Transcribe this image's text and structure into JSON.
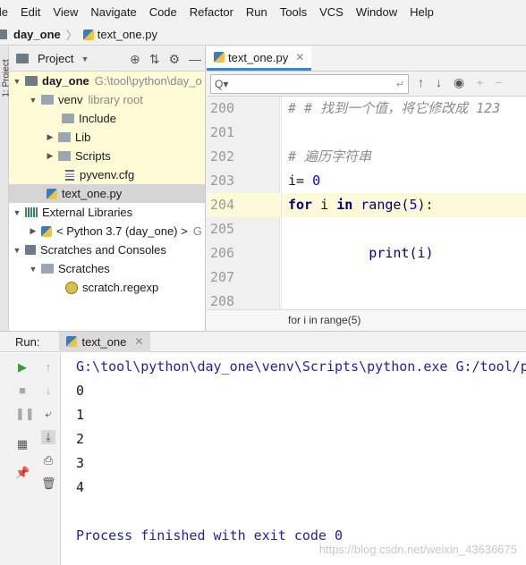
{
  "menu": [
    "ile",
    "Edit",
    "View",
    "Navigate",
    "Code",
    "Refactor",
    "Run",
    "Tools",
    "VCS",
    "Window",
    "Help"
  ],
  "nav": {
    "project": "day_one",
    "file": "text_one.py"
  },
  "stripe_label": "1: Project",
  "project_panel": {
    "title": "Project",
    "tree": [
      {
        "label": "day_one",
        "extra": "G:\\tool\\python\\day_o",
        "bold": true
      },
      {
        "label": "venv",
        "extra": "library root"
      },
      {
        "label": "Include"
      },
      {
        "label": "Lib"
      },
      {
        "label": "Scripts"
      },
      {
        "label": "pyvenv.cfg"
      },
      {
        "label": "text_one.py"
      },
      {
        "label": "External Libraries"
      },
      {
        "label": "< Python 3.7 (day_one) >",
        "extra": "G"
      },
      {
        "label": "Scratches and Consoles"
      },
      {
        "label": "Scratches"
      },
      {
        "label": "scratch.regexp"
      }
    ]
  },
  "editor": {
    "tab": "text_one.py",
    "search_placeholder": "Q▾",
    "line_numbers": [
      "200",
      "201",
      "202",
      "203",
      "204",
      "205",
      "206",
      "207",
      "208"
    ],
    "code": {
      "l200": "# # 找到一个值，将它修改成 123",
      "l202": "# 遍历字符串",
      "l203a": "i",
      "l203b": "= ",
      "l203c": "0",
      "l204_for": "for",
      "l204_i": " i ",
      "l204_in": "in",
      "l204_range": " range(",
      "l204_num": "5",
      "l204_end": "):",
      "l205": "    print(i)"
    },
    "breadcrumb": "for i in range(5)"
  },
  "run": {
    "label": "Run:",
    "tab": "text_one",
    "output": [
      "G:\\tool\\python\\day_one\\venv\\Scripts\\python.exe G:/tool/p",
      "0",
      "1",
      "2",
      "3",
      "4",
      "",
      "Process finished with exit code 0"
    ],
    "watermark": "https://blog.csdn.net/weixin_43636675"
  }
}
